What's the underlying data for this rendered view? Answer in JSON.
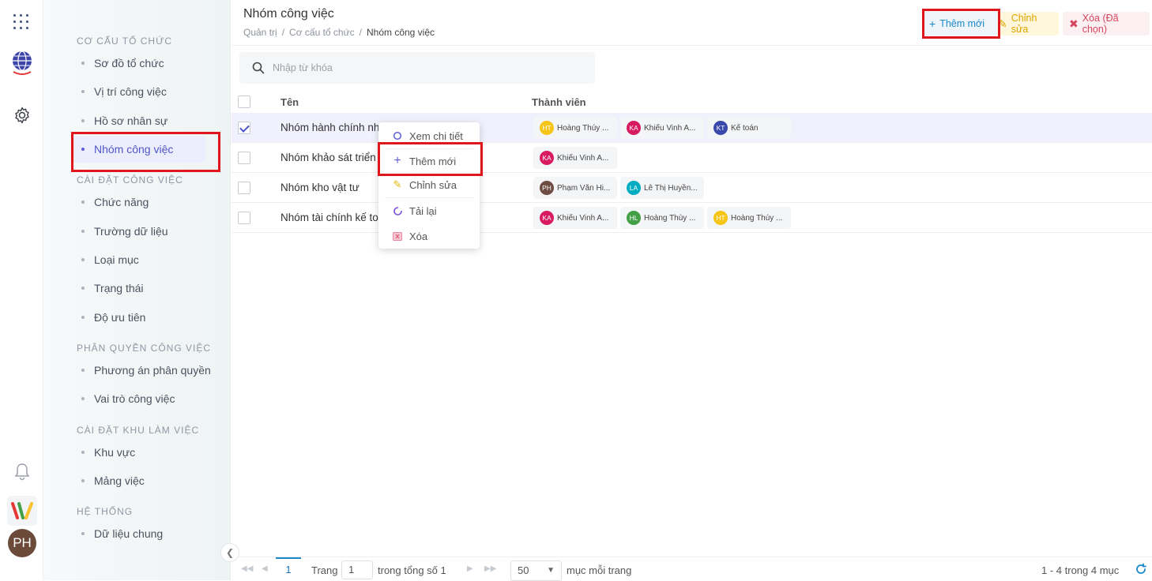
{
  "rail": {
    "avatar_initials": "PH"
  },
  "sidebar": {
    "sections": [
      {
        "title": "CƠ CẤU TỔ CHỨC",
        "items": [
          "Sơ đồ tổ chức",
          "Vị trí công việc",
          "Hồ sơ nhân sự",
          "Nhóm công việc"
        ]
      },
      {
        "title": "CÀI ĐẶT CÔNG VIỆC",
        "items": [
          "Chức năng",
          "Trường dữ liệu",
          "Loại mục",
          "Trạng thái",
          "Độ ưu tiên"
        ]
      },
      {
        "title": "PHÂN QUYỀN CÔNG VIỆC",
        "items": [
          "Phương án phân quyền",
          "Vai trò công việc"
        ]
      },
      {
        "title": "CÀI ĐẶT KHU LÀM VIỆC",
        "items": [
          "Khu vực",
          "Mảng việc"
        ]
      },
      {
        "title": "HỆ THỐNG",
        "items": [
          "Dữ liệu chung"
        ]
      }
    ],
    "active_item": "Nhóm công việc"
  },
  "header": {
    "title": "Nhóm công việc",
    "breadcrumb": [
      "Quản trị",
      "Cơ cấu tổ chức",
      "Nhóm công việc"
    ]
  },
  "toolbar": {
    "add_label": "Thêm mới",
    "edit_label": "Chỉnh sửa",
    "delete_label": "Xóa (Đã chọn)"
  },
  "search": {
    "placeholder": "Nhập từ khóa",
    "value": ""
  },
  "table": {
    "columns": [
      "Tên",
      "Thành viên"
    ],
    "rows": [
      {
        "name": "Nhóm hành chính nhân sự",
        "selected": true,
        "members": [
          {
            "initials": "HT",
            "name": "Hoàng Thúy ...",
            "color": "#f5c518"
          },
          {
            "initials": "KA",
            "name": "Khiếu Vinh A...",
            "color": "#d81b60"
          },
          {
            "initials": "KT",
            "name": "Kế toán",
            "color": "#3949ab"
          }
        ]
      },
      {
        "name": "Nhóm khảo sát triển khai",
        "selected": false,
        "members": [
          {
            "initials": "KA",
            "name": "Khiếu Vinh A...",
            "color": "#d81b60"
          }
        ]
      },
      {
        "name": "Nhóm kho vật tư",
        "selected": false,
        "members": [
          {
            "initials": "PH",
            "name": "Phạm Văn Hi...",
            "color": "#6d4c41"
          },
          {
            "initials": "LA",
            "name": "Lê Thị Huyền...",
            "color": "#00acc1"
          }
        ]
      },
      {
        "name": "Nhóm tài chính kế toán",
        "selected": false,
        "members": [
          {
            "initials": "KA",
            "name": "Khiếu Vinh A...",
            "color": "#d81b60"
          },
          {
            "initials": "HL",
            "name": "Hoàng Thùy ...",
            "color": "#43a047"
          },
          {
            "initials": "HT",
            "name": "Hoàng Thúy ...",
            "color": "#f5c518"
          }
        ]
      }
    ]
  },
  "context_menu": {
    "items": [
      "Xem chi tiết",
      "Thêm mới",
      "Chỉnh sửa",
      "Tải lại",
      "Xóa"
    ]
  },
  "pagination": {
    "current_page": "1",
    "page_label": "Trang",
    "page_input": "1",
    "total_label": "trong tổng số 1",
    "page_size": "50",
    "page_size_label": "mục mỗi trang",
    "summary": "1 - 4 trong 4 mục"
  },
  "colors": {
    "accent": "#4f55c8",
    "add": "#1a88c8",
    "edit": "#e0a400",
    "delete": "#d6455f",
    "highlight": "#e0161b"
  }
}
